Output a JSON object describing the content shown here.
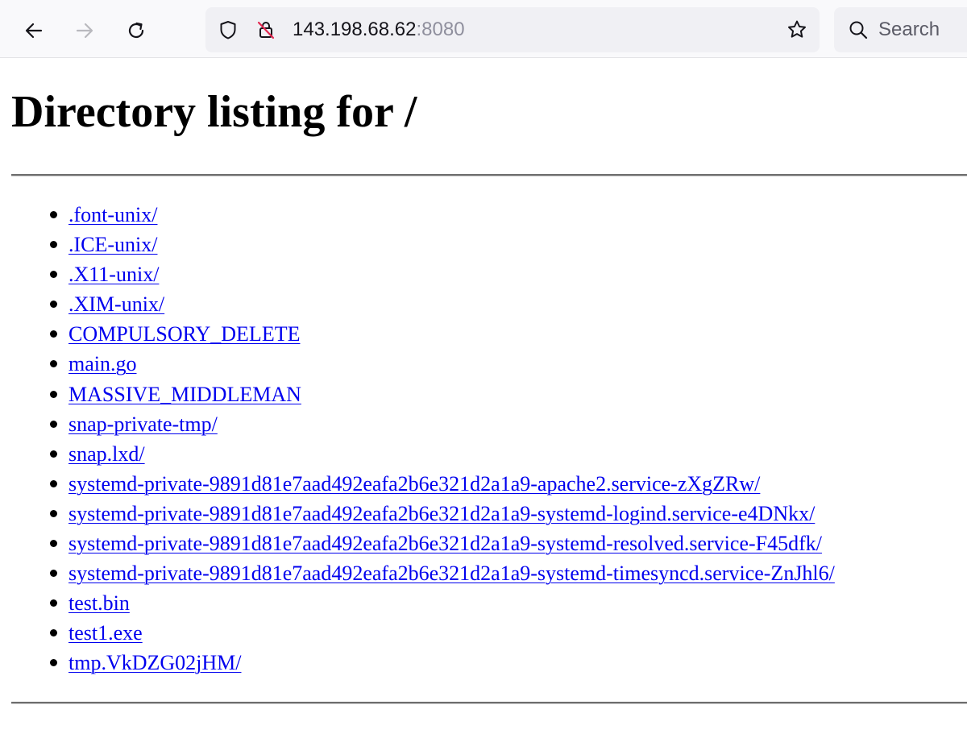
{
  "browser": {
    "url_host": "143.198.68.62",
    "url_port": ":8080",
    "search_placeholder": "Search",
    "icons": {
      "back": "arrow-left-icon",
      "forward": "arrow-right-icon",
      "reload": "reload-icon",
      "tracking_protection": "shield-icon",
      "insecure_connection": "insecure-lock-icon",
      "bookmark": "star-icon",
      "search": "search-icon"
    },
    "forward_enabled": false
  },
  "page": {
    "title": "Directory listing for /",
    "entries": [
      ".font-unix/",
      ".ICE-unix/",
      ".X11-unix/",
      ".XIM-unix/",
      "COMPULSORY_DELETE",
      "main.go",
      "MASSIVE_MIDDLEMAN",
      "snap-private-tmp/",
      "snap.lxd/",
      "systemd-private-9891d81e7aad492eafa2b6e321d2a1a9-apache2.service-zXgZRw/",
      "systemd-private-9891d81e7aad492eafa2b6e321d2a1a9-systemd-logind.service-e4DNkx/",
      "systemd-private-9891d81e7aad492eafa2b6e321d2a1a9-systemd-resolved.service-F45dfk/",
      "systemd-private-9891d81e7aad492eafa2b6e321d2a1a9-systemd-timesyncd.service-ZnJhl6/",
      "test.bin",
      "test1.exe",
      "tmp.VkDZG02jHM/"
    ]
  },
  "colors": {
    "link": "#0000ee",
    "toolbar_bg": "#f9f9fb",
    "urlbar_bg": "#f0f0f4",
    "insecure_red": "#e22850"
  }
}
